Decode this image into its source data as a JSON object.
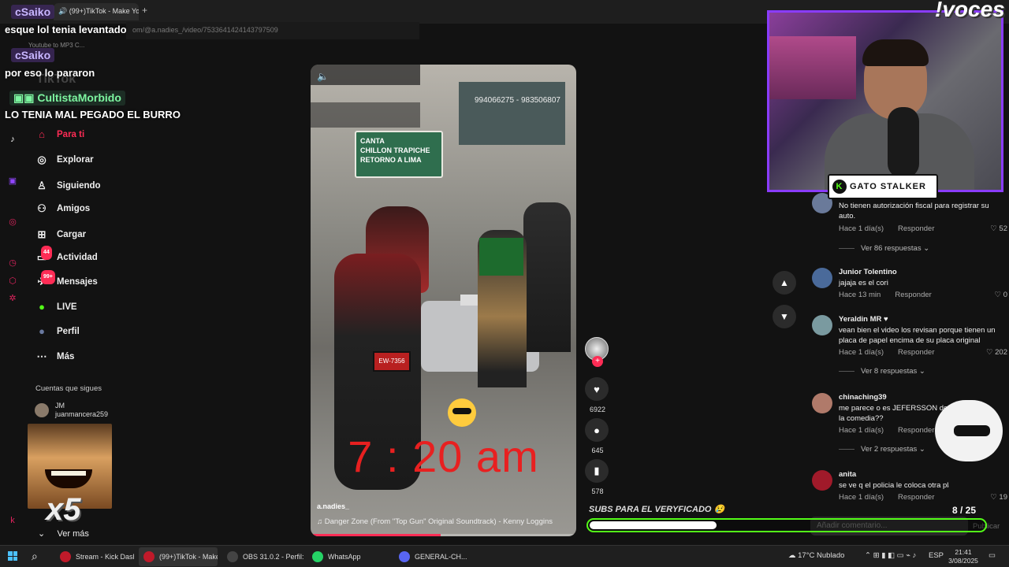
{
  "browser": {
    "tab_title": "(99+)TikTok - Make Yo",
    "url_text": "om/@a.nadies_/video/7533641424143797509",
    "bookmark": "Youtube to MP3 C..."
  },
  "stream_chat": [
    {
      "user": "cSaiko",
      "message": "esque lol tenia levantado"
    },
    {
      "user": "cSaiko",
      "message": "por eso lo pararon"
    },
    {
      "user": "CultistaMorbido",
      "message": "LO TENIA MAL PEGADO EL BURRO"
    }
  ],
  "tiktok_watermark": "TikTok",
  "sidebar": {
    "items": [
      {
        "label": "Para ti",
        "icon": "home-icon"
      },
      {
        "label": "Explorar",
        "icon": "compass-icon"
      },
      {
        "label": "Siguiendo",
        "icon": "user-follow-icon"
      },
      {
        "label": "Amigos",
        "icon": "friends-icon"
      },
      {
        "label": "Cargar",
        "icon": "upload-icon"
      },
      {
        "label": "Actividad",
        "icon": "activity-icon",
        "badge": "44"
      },
      {
        "label": "Mensajes",
        "icon": "messages-icon",
        "badge": "99+"
      },
      {
        "label": "LIVE",
        "icon": "live-icon"
      },
      {
        "label": "Perfil",
        "icon": "profile-icon"
      },
      {
        "label": "Más",
        "icon": "more-icon"
      }
    ],
    "following_title": "Cuentas que sigues",
    "following": [
      {
        "name": "JM",
        "handle": "juanmancera259"
      }
    ],
    "see_more": "Ver más"
  },
  "video": {
    "sign_text": "CANTA\nCHILLON TRAPICHE\nRETORNO A LIMA",
    "billboard_phone": "994066275 - 983506807",
    "plate": "EW-7356",
    "overlay_time": "7 : 20  am",
    "author": "a.nadies_",
    "music": "♫ Danger Zone (From \"Top Gun\" Original Soundtrack) - Kenny Loggins",
    "progress": 0.49
  },
  "actions": {
    "likes": "6922",
    "comments": "645",
    "saves": "578"
  },
  "comments": [
    {
      "user": "",
      "text": "No tienen autorización fiscal para registrar su auto.",
      "time": "Hace 1 día(s)",
      "reply": "Responder",
      "likes": "52",
      "replies": "Ver 86 respuestas",
      "avatar": "#6a7a9a"
    },
    {
      "user": "Junior Tolentino",
      "text": "jajaja es el cori",
      "time": "Hace 13 min",
      "reply": "Responder",
      "likes": "0",
      "replies": "",
      "avatar": "#4a6a9a"
    },
    {
      "user": "Yeraldin MR ♥",
      "text": "vean bien el video los revisan porque tienen un placa de papel encima de su placa original",
      "time": "Hace 1 día(s)",
      "reply": "Responder",
      "likes": "202",
      "replies": "Ver 8 respuestas",
      "avatar": "#7a9aa0"
    },
    {
      "user": "chinaching39",
      "text": "me parece o es JEFERSSON de la comedia??",
      "time": "Hace 1 día(s)",
      "reply": "Responder",
      "likes": "",
      "replies": "Ver 2 respuestas",
      "avatar": "#b07a6a"
    },
    {
      "user": "anita",
      "text": "se ve q el policia le coloca otra placa",
      "time": "Hace 1 día(s)",
      "reply": "Responder",
      "likes": "19",
      "replies": "",
      "avatar": "#a01a2a"
    }
  ],
  "comment_input": {
    "placeholder": "Añadir comentario...",
    "post": "Publicar"
  },
  "stream_overlay": {
    "voces": "!voces",
    "name_tag": "GATO STALKER",
    "subs_goal": "SUBS PARA EL VERYFICADO 😢",
    "goal_count": "8 / 25",
    "goal_progress": 0.32,
    "meme_multiplier": "x5"
  },
  "taskbar": {
    "apps": [
      {
        "label": "Stream - Kick Dash...",
        "color": "#c01a2a",
        "active": false
      },
      {
        "label": "(99+)TikTok - Make...",
        "color": "#c01a2a",
        "active": true
      },
      {
        "label": "OBS 31.0.2 - Perfil: ...",
        "color": "#444444",
        "active": false
      },
      {
        "label": "WhatsApp",
        "color": "#25d366",
        "active": false
      },
      {
        "label": "GENERAL-CH...",
        "color": "#5865f2",
        "active": false
      }
    ],
    "weather": "17°C  Nublado",
    "lang": "ESP",
    "time": "21:41",
    "date": "3/08/2025"
  }
}
